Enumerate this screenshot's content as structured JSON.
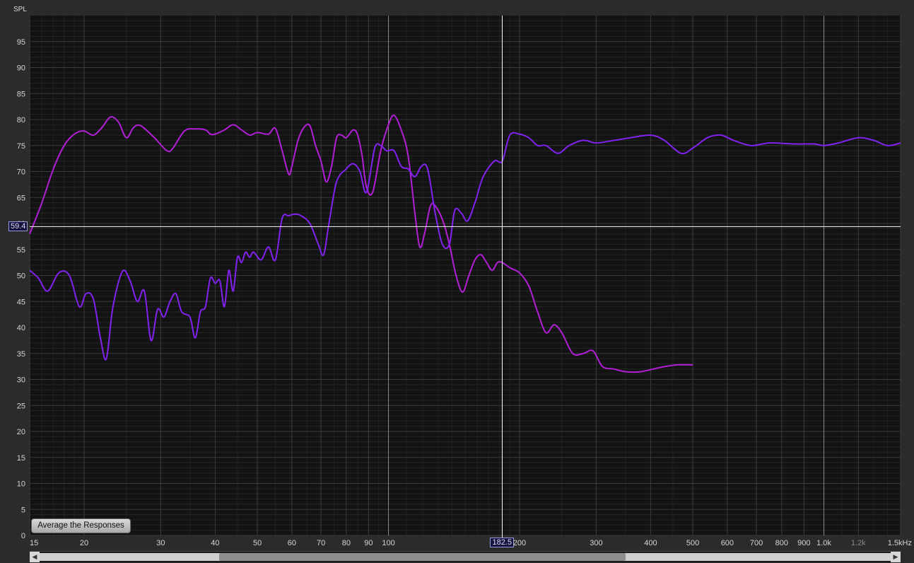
{
  "ylabel_top": "SPL",
  "cursor": {
    "y_value": "59.4",
    "x_value": "182.5"
  },
  "average_button": "Average the Responses",
  "colors": {
    "series_a": "#b21fd6",
    "series_b": "#8222f0",
    "cursor": "#ffffff"
  },
  "chart_data": {
    "type": "line",
    "xscale": "log",
    "xlim": [
      15,
      1500
    ],
    "ylim": [
      0,
      100
    ],
    "grid": true,
    "y_ticks": [
      0,
      5,
      10,
      15,
      20,
      25,
      30,
      35,
      40,
      45,
      50,
      55,
      60,
      65,
      70,
      75,
      80,
      85,
      90,
      95
    ],
    "x_ticks": [
      {
        "v": 15,
        "l": "15"
      },
      {
        "v": 20,
        "l": "20"
      },
      {
        "v": 30,
        "l": "30"
      },
      {
        "v": 40,
        "l": "40"
      },
      {
        "v": 50,
        "l": "50"
      },
      {
        "v": 60,
        "l": "60"
      },
      {
        "v": 70,
        "l": "70"
      },
      {
        "v": 80,
        "l": "80"
      },
      {
        "v": 90,
        "l": "90"
      },
      {
        "v": 100,
        "l": "100"
      },
      {
        "v": 200,
        "l": "200"
      },
      {
        "v": 300,
        "l": "300"
      },
      {
        "v": 400,
        "l": "400"
      },
      {
        "v": 500,
        "l": "500"
      },
      {
        "v": 600,
        "l": "600"
      },
      {
        "v": 700,
        "l": "700"
      },
      {
        "v": 800,
        "l": "800"
      },
      {
        "v": 900,
        "l": "900"
      },
      {
        "v": 1000,
        "l": "1.0k"
      },
      {
        "v": 1200,
        "l": "1.2k"
      },
      {
        "v": 1500,
        "l": "1.5kHz"
      }
    ],
    "series": [
      {
        "color": "#b21fd6",
        "points": [
          [
            15,
            58
          ],
          [
            16,
            64
          ],
          [
            17,
            70.5
          ],
          [
            18,
            75
          ],
          [
            19,
            77.2
          ],
          [
            20,
            77.8
          ],
          [
            21,
            77
          ],
          [
            22,
            78.5
          ],
          [
            23,
            80.5
          ],
          [
            24,
            79.5
          ],
          [
            25,
            76.5
          ],
          [
            26,
            78.5
          ],
          [
            27,
            78.8
          ],
          [
            29,
            76.5
          ],
          [
            31,
            74
          ],
          [
            32,
            74.5
          ],
          [
            34,
            77.8
          ],
          [
            36,
            78.2
          ],
          [
            38,
            78
          ],
          [
            39,
            77.2
          ],
          [
            40,
            77.2
          ],
          [
            42,
            78
          ],
          [
            44,
            79
          ],
          [
            46,
            78
          ],
          [
            48,
            77
          ],
          [
            50,
            77.5
          ],
          [
            53,
            77.2
          ],
          [
            55,
            78.3
          ],
          [
            57,
            74
          ],
          [
            59,
            69.5
          ],
          [
            60,
            71
          ],
          [
            62,
            76
          ],
          [
            64,
            78.5
          ],
          [
            66,
            78.8
          ],
          [
            68,
            75
          ],
          [
            70,
            72
          ],
          [
            72,
            68
          ],
          [
            74,
            71
          ],
          [
            76,
            76.5
          ],
          [
            78,
            77
          ],
          [
            80,
            76.5
          ],
          [
            83,
            78
          ],
          [
            85,
            77
          ],
          [
            87,
            73
          ],
          [
            89,
            67
          ],
          [
            92,
            66
          ],
          [
            96,
            74
          ],
          [
            100,
            79
          ],
          [
            103,
            80.8
          ],
          [
            107,
            78
          ],
          [
            111,
            73
          ],
          [
            115,
            62
          ],
          [
            118,
            55.5
          ],
          [
            121,
            58
          ],
          [
            125,
            63.5
          ],
          [
            129,
            63
          ],
          [
            134,
            60
          ],
          [
            138,
            56
          ],
          [
            143,
            50
          ],
          [
            148,
            46.8
          ],
          [
            153,
            50
          ],
          [
            158,
            53
          ],
          [
            163,
            54
          ],
          [
            168,
            52.5
          ],
          [
            173,
            51
          ],
          [
            178,
            52.5
          ],
          [
            182.5,
            52.5
          ],
          [
            190,
            51.5
          ],
          [
            200,
            50.5
          ],
          [
            210,
            48
          ],
          [
            220,
            43
          ],
          [
            230,
            39
          ],
          [
            240,
            40.5
          ],
          [
            250,
            39
          ],
          [
            265,
            35
          ],
          [
            280,
            35
          ],
          [
            295,
            35.5
          ],
          [
            310,
            32.5
          ],
          [
            330,
            32
          ],
          [
            350,
            31.5
          ],
          [
            380,
            31.5
          ],
          [
            420,
            32.3
          ],
          [
            460,
            32.8
          ],
          [
            500,
            32.8
          ]
        ]
      },
      {
        "color": "#8222f0",
        "points": [
          [
            15,
            51
          ],
          [
            15.7,
            49.5
          ],
          [
            16.5,
            47
          ],
          [
            17.5,
            50.5
          ],
          [
            18.5,
            50
          ],
          [
            19.5,
            44
          ],
          [
            20.2,
            46.5
          ],
          [
            21,
            45.5
          ],
          [
            21.8,
            38
          ],
          [
            22.5,
            34
          ],
          [
            23.3,
            44
          ],
          [
            24.5,
            50.8
          ],
          [
            25.5,
            49
          ],
          [
            26.5,
            45
          ],
          [
            27.5,
            47
          ],
          [
            28.5,
            37.5
          ],
          [
            29.5,
            43.5
          ],
          [
            30.5,
            42
          ],
          [
            31.5,
            45
          ],
          [
            32.5,
            46.5
          ],
          [
            33.5,
            43
          ],
          [
            35,
            42
          ],
          [
            36,
            38
          ],
          [
            37,
            43
          ],
          [
            38,
            44
          ],
          [
            39,
            49.5
          ],
          [
            40,
            48.5
          ],
          [
            41,
            49
          ],
          [
            42,
            44
          ],
          [
            43,
            51
          ],
          [
            44,
            47
          ],
          [
            45,
            53.5
          ],
          [
            46,
            52.5
          ],
          [
            47,
            54.5
          ],
          [
            48,
            53.5
          ],
          [
            49,
            54.5
          ],
          [
            51,
            53
          ],
          [
            53,
            55.5
          ],
          [
            55,
            53
          ],
          [
            57,
            61
          ],
          [
            59,
            61.5
          ],
          [
            61,
            61.8
          ],
          [
            63,
            61.5
          ],
          [
            66,
            60
          ],
          [
            69,
            56
          ],
          [
            71,
            54
          ],
          [
            73,
            60
          ],
          [
            76,
            68
          ],
          [
            80,
            70.5
          ],
          [
            83,
            71.5
          ],
          [
            86,
            70
          ],
          [
            89,
            66
          ],
          [
            93,
            74.5
          ],
          [
            96,
            75
          ],
          [
            99,
            74
          ],
          [
            103,
            74
          ],
          [
            107,
            71
          ],
          [
            111,
            70.5
          ],
          [
            115,
            69
          ],
          [
            119,
            71
          ],
          [
            123,
            70.5
          ],
          [
            128,
            62
          ],
          [
            133,
            56
          ],
          [
            138,
            56
          ],
          [
            142,
            62.5
          ],
          [
            147,
            62
          ],
          [
            152,
            60.5
          ],
          [
            158,
            64
          ],
          [
            165,
            69
          ],
          [
            175,
            72
          ],
          [
            182.5,
            72
          ],
          [
            190,
            77
          ],
          [
            200,
            77.2
          ],
          [
            210,
            76.5
          ],
          [
            220,
            75
          ],
          [
            230,
            75
          ],
          [
            245,
            73.5
          ],
          [
            260,
            75
          ],
          [
            280,
            76
          ],
          [
            300,
            75.5
          ],
          [
            330,
            76
          ],
          [
            360,
            76.5
          ],
          [
            400,
            77
          ],
          [
            430,
            76
          ],
          [
            470,
            73.5
          ],
          [
            500,
            74.5
          ],
          [
            540,
            76.5
          ],
          [
            580,
            77
          ],
          [
            620,
            76
          ],
          [
            680,
            75
          ],
          [
            750,
            75.5
          ],
          [
            850,
            75.3
          ],
          [
            950,
            75.3
          ],
          [
            1000,
            75
          ],
          [
            1080,
            75.5
          ],
          [
            1200,
            76.5
          ],
          [
            1300,
            76
          ],
          [
            1400,
            75
          ],
          [
            1500,
            75.5
          ]
        ]
      }
    ]
  }
}
